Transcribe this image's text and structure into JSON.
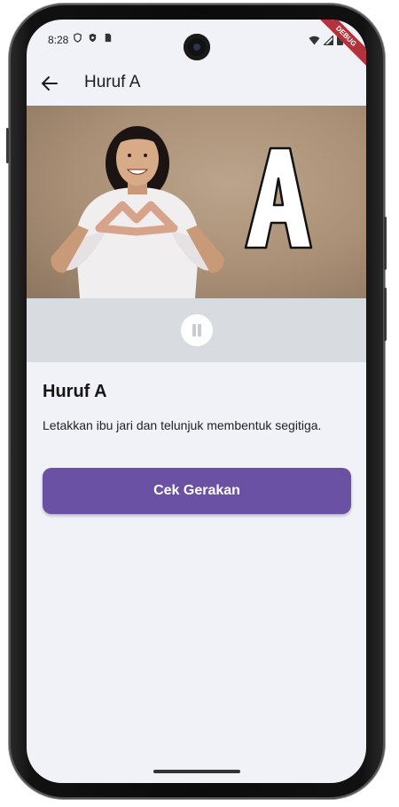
{
  "status_bar": {
    "time": "8:28",
    "left_icons": [
      "shield-icon",
      "shield-check-icon",
      "sim-card-icon"
    ],
    "right_icons": [
      "wifi-icon",
      "signal-icon",
      "battery-icon"
    ],
    "debug_label": "DEBUG"
  },
  "app_bar": {
    "back_icon": "arrow-left-icon",
    "title": "Huruf A"
  },
  "video": {
    "overlay_letter": "A",
    "control_icon": "pause-icon"
  },
  "content": {
    "heading": "Huruf A",
    "description": "Letakkan ibu jari dan telunjuk membentuk segitiga.",
    "button_label": "Cek Gerakan"
  },
  "colors": {
    "accent": "#6a51a3",
    "background": "#f0f2f8",
    "controls_bg": "#d8dbe0",
    "debug_banner": "#b3323b"
  }
}
